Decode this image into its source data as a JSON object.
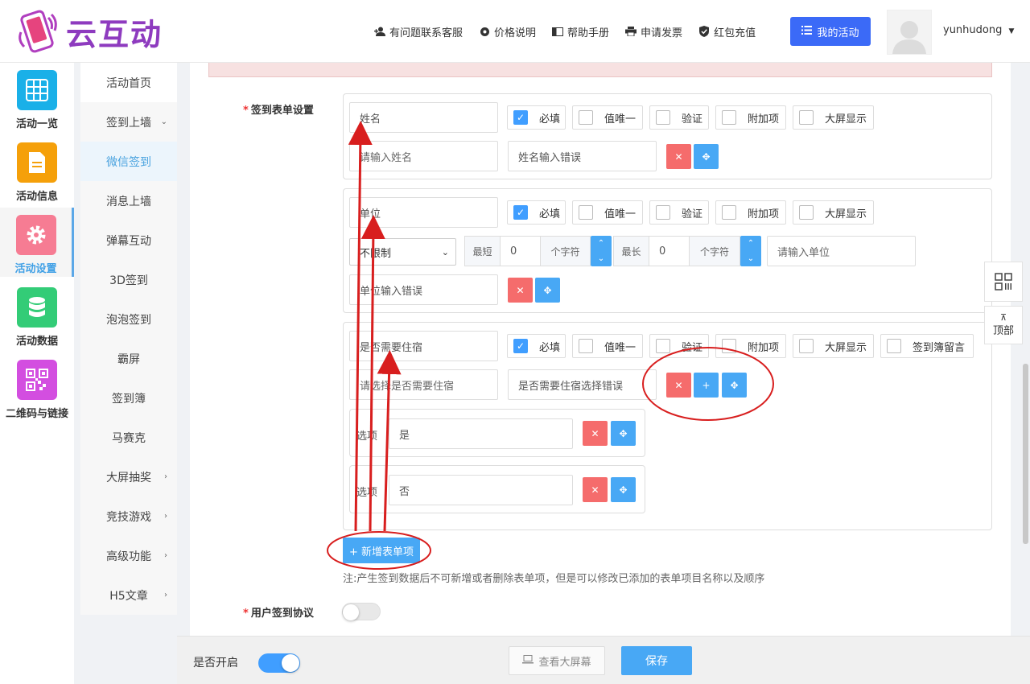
{
  "brand": {
    "name": "云互动"
  },
  "top_nav": [
    {
      "icon": "user-plus-icon",
      "label": "有问题联系客服"
    },
    {
      "icon": "gear-icon",
      "label": "价格说明"
    },
    {
      "icon": "book-icon",
      "label": "帮助手册"
    },
    {
      "icon": "printer-icon",
      "label": "申请发票"
    },
    {
      "icon": "shield-check-icon",
      "label": "红包充值"
    }
  ],
  "my_activity": "我的活动",
  "user": {
    "name": "yunhudong"
  },
  "rail": [
    {
      "label": "活动一览",
      "color": "#1ab0e8",
      "icon": "grid-icon"
    },
    {
      "label": "活动信息",
      "color": "#f5a00a",
      "icon": "document-icon"
    },
    {
      "label": "活动设置",
      "color": "#f67c93",
      "icon": "gear-icon"
    },
    {
      "label": "活动数据",
      "color": "#33cc77",
      "icon": "database-icon"
    },
    {
      "label": "二维码与链接",
      "color": "#d34ee0",
      "icon": "qrcode-icon"
    }
  ],
  "submenu": [
    {
      "label": "活动首页"
    },
    {
      "label": "签到上墙"
    },
    {
      "label": "微信签到"
    },
    {
      "label": "消息上墙"
    },
    {
      "label": "弹幕互动"
    },
    {
      "label": "3D签到"
    },
    {
      "label": "泡泡签到"
    },
    {
      "label": "霸屏"
    },
    {
      "label": "签到簿"
    },
    {
      "label": "马赛克"
    },
    {
      "label": "大屏抽奖"
    },
    {
      "label": "竞技游戏"
    },
    {
      "label": "高级功能"
    },
    {
      "label": "H5文章"
    }
  ],
  "form": {
    "section_label": "签到表单设置",
    "checks": {
      "required": "必填",
      "unique": "值唯一",
      "verify": "验证",
      "extra": "附加项",
      "big_screen": "大屏显示",
      "guestbook": "签到簿留言"
    },
    "item1": {
      "name": "姓名",
      "placeholder": "请输入姓名",
      "error": "姓名输入错误"
    },
    "item2": {
      "name": "单位",
      "limit": "不限制",
      "min_label": "最短",
      "min_value": "0",
      "max_label": "最长",
      "max_value": "0",
      "unit": "个字符",
      "placeholder": "请输入单位",
      "error": "单位输入错误"
    },
    "item3": {
      "name": "是否需要住宿",
      "placeholder": "请选择是否需要住宿",
      "error": "是否需要住宿选择错误",
      "option_label": "选项",
      "options": [
        "是",
        "否"
      ]
    },
    "add_item": "+ 新增表单项",
    "note": "注:产生签到数据后不可新增或者删除表单项，但是可以修改已添加的表单项目名称以及顺序",
    "agreement_label": "用户签到协议"
  },
  "bottom": {
    "enable_label": "是否开启",
    "view_screen": "查看大屏幕",
    "save": "保存"
  },
  "float": {
    "top_label": "顶部"
  },
  "annotation_color": "#d81e1e"
}
